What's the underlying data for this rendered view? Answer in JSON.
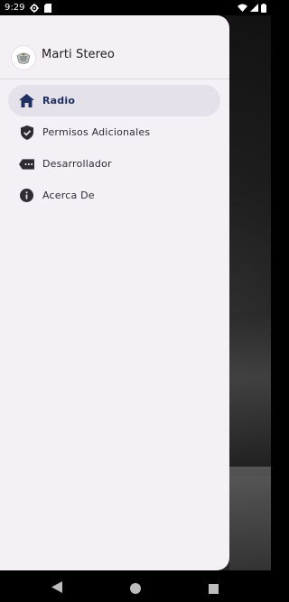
{
  "status_bar": {
    "time": "9:29",
    "icons_left": [
      "gear-icon",
      "sd-card-icon"
    ],
    "icons_right": [
      "wifi-icon",
      "signal-icon",
      "battery-icon"
    ]
  },
  "drawer": {
    "app_title": "Marti Stereo",
    "logo": "app-logo",
    "items": [
      {
        "label": "Radio",
        "icon": "home-icon",
        "active": true
      },
      {
        "label": "Permisos Adicionales",
        "icon": "shield-check-icon",
        "active": false
      },
      {
        "label": "Desarrollador",
        "icon": "tag-dots-icon",
        "active": false
      },
      {
        "label": "Acerca De",
        "icon": "info-icon",
        "active": false
      }
    ]
  },
  "colors": {
    "drawer_bg": "#f4f0f6",
    "active_item_bg": "#e5e1ea",
    "active_accent": "#1f2f62",
    "icon_color": "#2f2c33"
  },
  "nav_bar": {
    "buttons": [
      "back-icon",
      "home-circle-icon",
      "recents-icon"
    ]
  }
}
